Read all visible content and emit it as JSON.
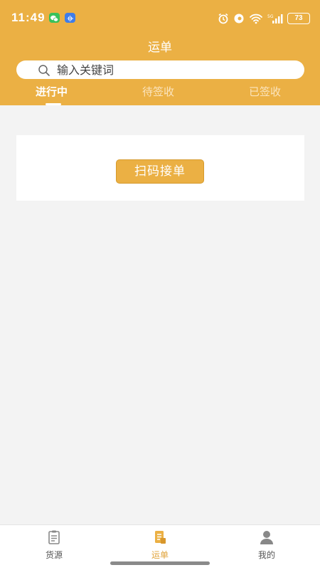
{
  "status_bar": {
    "time": "11:49",
    "battery": "73"
  },
  "header": {
    "title": "运单"
  },
  "search": {
    "placeholder": "输入关键词",
    "value": ""
  },
  "tabs": [
    {
      "label": "进行中",
      "active": true
    },
    {
      "label": "待签收",
      "active": false
    },
    {
      "label": "已签收",
      "active": false
    }
  ],
  "main": {
    "scan_button_label": "扫码接单"
  },
  "tab_bar": {
    "items": [
      {
        "label": "货源",
        "icon": "clipboard-icon",
        "active": false
      },
      {
        "label": "运单",
        "icon": "waybill-icon",
        "active": true
      },
      {
        "label": "我的",
        "icon": "person-icon",
        "active": false
      }
    ]
  },
  "colors": {
    "accent": "#ebb044",
    "background": "#f3f3f3",
    "tab_active_text": "#e0a33a"
  }
}
